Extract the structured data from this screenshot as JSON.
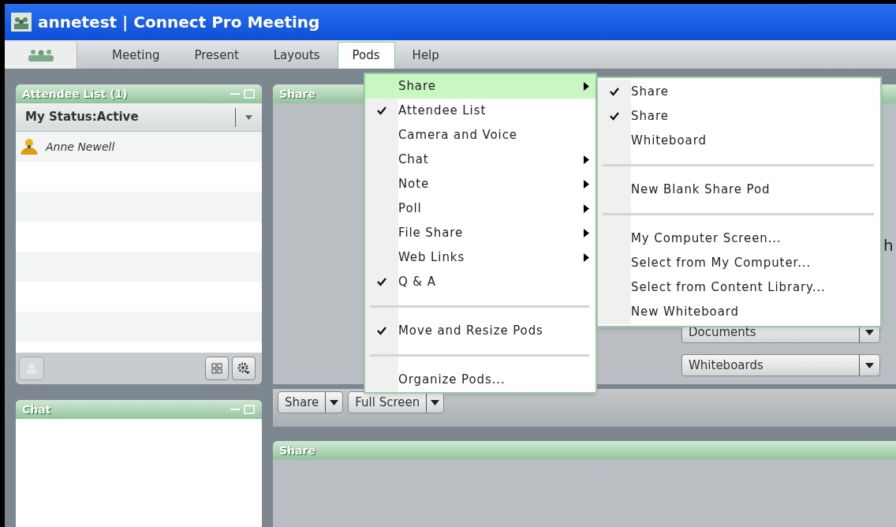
{
  "window": {
    "title": "annetest | Connect Pro Meeting"
  },
  "menu_bar": [
    {
      "label": "Meeting",
      "selected": false
    },
    {
      "label": "Present",
      "selected": false
    },
    {
      "label": "Layouts",
      "selected": false
    },
    {
      "label": "Pods",
      "selected": true
    },
    {
      "label": "Help",
      "selected": false
    }
  ],
  "attendee_pod": {
    "title": "Attendee List (1)",
    "status": "My Status:Active",
    "attendees": [
      "Anne Newell"
    ]
  },
  "chat_pod": {
    "title": "Chat"
  },
  "share_pod": {
    "title": "Share",
    "partial_text": "h",
    "dropdowns": [
      "Documents",
      "Whiteboards"
    ]
  },
  "share_toolbar": [
    "Share",
    "Full Screen"
  ],
  "share_pod_2": {
    "title": "Share"
  },
  "pods_menu": [
    {
      "kind": "item",
      "label": "Share",
      "checked": false,
      "submenu": true,
      "selected": true
    },
    {
      "kind": "item",
      "label": "Attendee List",
      "checked": true,
      "submenu": false,
      "selected": false
    },
    {
      "kind": "item",
      "label": "Camera and Voice",
      "checked": false,
      "submenu": false,
      "selected": false
    },
    {
      "kind": "item",
      "label": "Chat",
      "checked": false,
      "submenu": true,
      "selected": false
    },
    {
      "kind": "item",
      "label": "Note",
      "checked": false,
      "submenu": true,
      "selected": false
    },
    {
      "kind": "item",
      "label": "Poll",
      "checked": false,
      "submenu": true,
      "selected": false
    },
    {
      "kind": "item",
      "label": "File Share",
      "checked": false,
      "submenu": true,
      "selected": false
    },
    {
      "kind": "item",
      "label": "Web Links",
      "checked": false,
      "submenu": true,
      "selected": false
    },
    {
      "kind": "item",
      "label": "Q & A",
      "checked": true,
      "submenu": false,
      "selected": false
    },
    {
      "kind": "separator"
    },
    {
      "kind": "item",
      "label": "Move and Resize Pods",
      "checked": true,
      "submenu": false,
      "selected": false
    },
    {
      "kind": "separator"
    },
    {
      "kind": "item",
      "label": "Organize Pods...",
      "checked": false,
      "submenu": false,
      "selected": false
    }
  ],
  "share_submenu": [
    {
      "kind": "item",
      "label": "Share",
      "checked": true
    },
    {
      "kind": "item",
      "label": "Share",
      "checked": true
    },
    {
      "kind": "item",
      "label": "Whiteboard",
      "checked": false
    },
    {
      "kind": "separator"
    },
    {
      "kind": "item",
      "label": "New Blank Share Pod",
      "checked": false
    },
    {
      "kind": "separator"
    },
    {
      "kind": "item",
      "label": "My Computer Screen...",
      "checked": false
    },
    {
      "kind": "item",
      "label": "Select from My Computer...",
      "checked": false
    },
    {
      "kind": "item",
      "label": "Select from Content Library...",
      "checked": false
    },
    {
      "kind": "item",
      "label": "New Whiteboard",
      "checked": false
    }
  ]
}
